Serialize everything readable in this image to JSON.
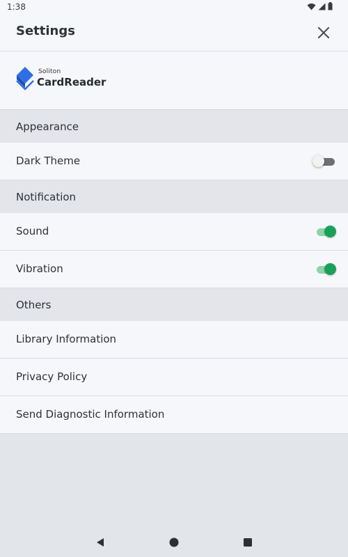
{
  "status": {
    "time": "1:38",
    "icons": [
      "wifi-icon",
      "signal-icon",
      "battery-icon"
    ]
  },
  "header": {
    "title": "Settings",
    "close_icon": "close-icon"
  },
  "logo": {
    "small": "Soliton",
    "big": "CardReader"
  },
  "sections": {
    "appearance": {
      "title": "Appearance",
      "items": [
        {
          "label": "Dark Theme",
          "toggle": false
        }
      ]
    },
    "notification": {
      "title": "Notification",
      "items": [
        {
          "label": "Sound",
          "toggle": true
        },
        {
          "label": "Vibration",
          "toggle": true
        }
      ]
    },
    "others": {
      "title": "Others",
      "items": [
        {
          "label": "Library Information"
        },
        {
          "label": "Privacy Policy"
        },
        {
          "label": "Send Diagnostic Information"
        }
      ]
    }
  },
  "colors": {
    "accent": "#19a158",
    "logo_blue": "#2f6fe4"
  },
  "navbar": [
    "back-icon",
    "home-icon",
    "recents-icon"
  ]
}
